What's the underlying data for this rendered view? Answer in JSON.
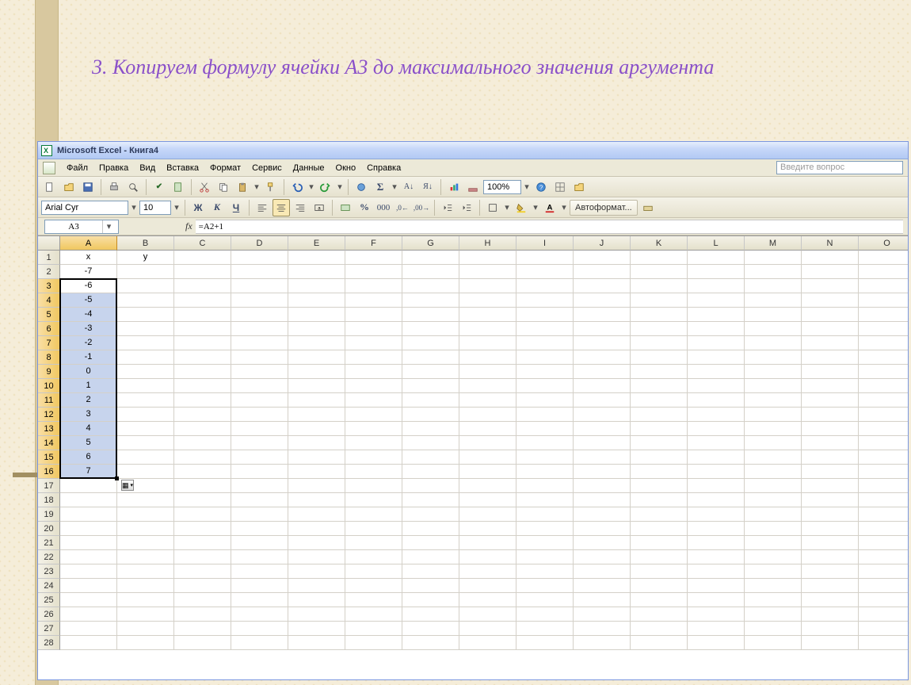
{
  "slide": {
    "title": "3. Копируем формулу ячейки А3 до максимального значения аргумента"
  },
  "titlebar": {
    "text": "Microsoft Excel - Книга4"
  },
  "menu": {
    "file": "Файл",
    "edit": "Правка",
    "view": "Вид",
    "insert": "Вставка",
    "format": "Формат",
    "tools": "Сервис",
    "data": "Данные",
    "window": "Окно",
    "help": "Справка"
  },
  "helpbox": {
    "placeholder": "Введите вопрос"
  },
  "toolbar": {
    "zoom": "100%"
  },
  "format_toolbar": {
    "font": "Arial Cyr",
    "size": "10",
    "bold": "Ж",
    "italic": "К",
    "underline": "Ч",
    "autoformat": "Автоформат..."
  },
  "namebox": {
    "value": "A3"
  },
  "formula": {
    "fx": "fx",
    "value": "=A2+1"
  },
  "columns": [
    "A",
    "B",
    "C",
    "D",
    "E",
    "F",
    "G",
    "H",
    "I",
    "J",
    "K",
    "L",
    "M",
    "N",
    "O"
  ],
  "rows": [
    "1",
    "2",
    "3",
    "4",
    "5",
    "6",
    "7",
    "8",
    "9",
    "10",
    "11",
    "12",
    "13",
    "14",
    "15",
    "16",
    "17",
    "18",
    "19",
    "20",
    "21",
    "22",
    "23",
    "24",
    "25",
    "26",
    "27",
    "28"
  ],
  "sheet": {
    "A1": "x",
    "B1": "y",
    "A2": "-7",
    "A3": "-6",
    "A4": "-5",
    "A5": "-4",
    "A6": "-3",
    "A7": "-2",
    "A8": "-1",
    "A9": "0",
    "A10": "1",
    "A11": "2",
    "A12": "3",
    "A13": "4",
    "A14": "5",
    "A15": "6",
    "A16": "7"
  },
  "selection": {
    "col": "A",
    "rows_from": 3,
    "rows_to": 16
  }
}
